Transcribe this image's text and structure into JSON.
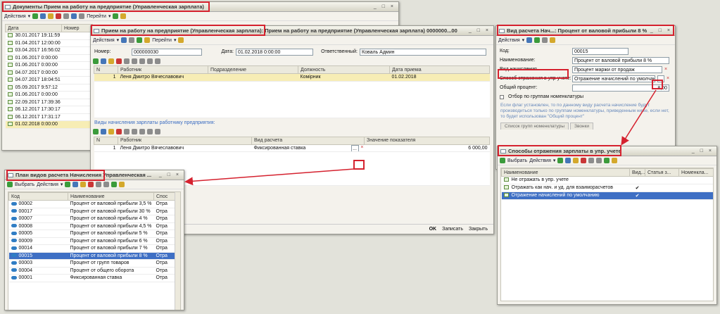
{
  "win1": {
    "title": "Документы Прием на работу на предприятие (Управленческая зарплата)",
    "controls": "_ □ ×",
    "actions": "Действия",
    "goto": "Перейти",
    "headers": [
      "Дата",
      "Номер"
    ],
    "rows": [
      "30.01.2017 19:11:59",
      "01.04.2017 12:00:00",
      "03.04.2017 16:56:02",
      "01.06.2017 0:00:00",
      "01.06.2017 0:00:00",
      "04.07.2017 0:00:00",
      "04.07.2017 18:04:51",
      "05.09.2017 9:57:12",
      "01.06.2017 0:00:00",
      "22.09.2017 17:39:36",
      "06.12.2017 17:30:17",
      "06.12.2017 17:31:17",
      "01.02.2018 0:00:00"
    ],
    "selected_index": 12
  },
  "win2": {
    "title": "Прием на работу на предприятие (Управленческая зарплата): Прием на работу на предприятие (Управленческая зарплата) 0000000...00",
    "controls": "_ □ ×",
    "actions": "Действия",
    "goto": "Перейти",
    "number_label": "Номер:",
    "number_value": "000000030",
    "date_label": "Дата:",
    "date_value": "01.02.2018 0:00:00",
    "resp_label": "Ответственный:",
    "resp_value": "Коваль Админ",
    "emp_headers": [
      "N",
      "Работник",
      "Подразделение",
      "Должность",
      "Дата приема"
    ],
    "emp_rows": [
      [
        "1",
        "Леня Дмитро Вячеславович",
        "",
        "Комірник",
        "01.02.2018"
      ]
    ],
    "section_label": "Виды начисления зарплаты работнику предприятия:",
    "acc_headers": [
      "N",
      "Работник",
      "Вид расчета",
      "Значение показателя"
    ],
    "acc_rows": [
      [
        "1",
        "Леня Дмитро Вячеславович",
        "Фиксированная ставка",
        "6 000,00"
      ]
    ],
    "btn_select": "...",
    "ok": "OK",
    "save": "Записать",
    "close": "Закрыть"
  },
  "win3": {
    "title": "Вид расчета Нач...: Процент от валовой прибыли 8 %",
    "controls": "_ □ ×",
    "actions": "Действия",
    "code_label": "Код:",
    "code_value": "00015",
    "name_label": "Наименование:",
    "name_value": "Процент от валовой прибыли 8 %",
    "kind_label": "Вид начисления",
    "kind_value": "Процент маржи от продаж",
    "method_label": "Способ отражения в упр учете:",
    "method_value": "Отражение начислений по умолчан",
    "percent_label": "Общий процент:",
    "percent_value": "8,00",
    "group_check_label": "Отбор по группам номенклатуры",
    "note": "Если флаг установлен, то по данному виду расчета начисление будут производиться только по группам номенклатуры, приведенным ниже, если нет, то будет использован \"Общий процент\"",
    "tabs": [
      "Список групп номенклатуры",
      "Звонки"
    ],
    "btn_select": "...",
    "btn_clear": "×"
  },
  "win4": {
    "title": "План видов расчета Начисления Управленческая ...",
    "controls": "_ □ ×",
    "select": "Выбрать",
    "actions": "Действия",
    "headers": [
      "Код",
      "Наименование",
      "Спос"
    ],
    "rows": [
      [
        "00002",
        "Процент от валовой прибыли 3,5 %",
        "Отра"
      ],
      [
        "00017",
        "Процент от валовой прибыли 30 %",
        "Отра"
      ],
      [
        "00007",
        "Процент от валовой прибыли 4 %",
        "Отра"
      ],
      [
        "00008",
        "Процент от валовой прибыли 4,5 %",
        "Отра"
      ],
      [
        "00005",
        "Процент от валовой прибыли 5 %",
        "Отра"
      ],
      [
        "00009",
        "Процент от валовой прибыли 6 %",
        "Отра"
      ],
      [
        "00014",
        "Процент от валовой прибыли 7 %",
        "Отра"
      ],
      [
        "00015",
        "Процент от валовой прибыли 8 %",
        "Отра"
      ],
      [
        "00003",
        "Процент от групп товаров",
        "Отра"
      ],
      [
        "00004",
        "Процент от общего оборота",
        "Отра"
      ],
      [
        "00001",
        "Фиксированная ставка",
        "Отра"
      ]
    ],
    "selected_index": 7
  },
  "win5": {
    "title": "Способы отражения зарплаты в упр. учете",
    "controls": "_ □ ×",
    "select": "Выбрать",
    "actions": "Действия",
    "headers": [
      "Наименование",
      "Вид...",
      "Статья з...",
      "Номенкла..."
    ],
    "rows": [
      [
        "Не отражать в упр. учете",
        "",
        ""
      ],
      [
        "Отражать как нач. и уд. для взаиморасчетов",
        "✔",
        ""
      ],
      [
        "Отражение начислений по умолчанию",
        "✔",
        ""
      ]
    ],
    "selected_index": 2
  },
  "colors": {
    "highlight": "#d5222f",
    "selection": "#3e6fc4",
    "row_selected": "#f7edb5"
  }
}
